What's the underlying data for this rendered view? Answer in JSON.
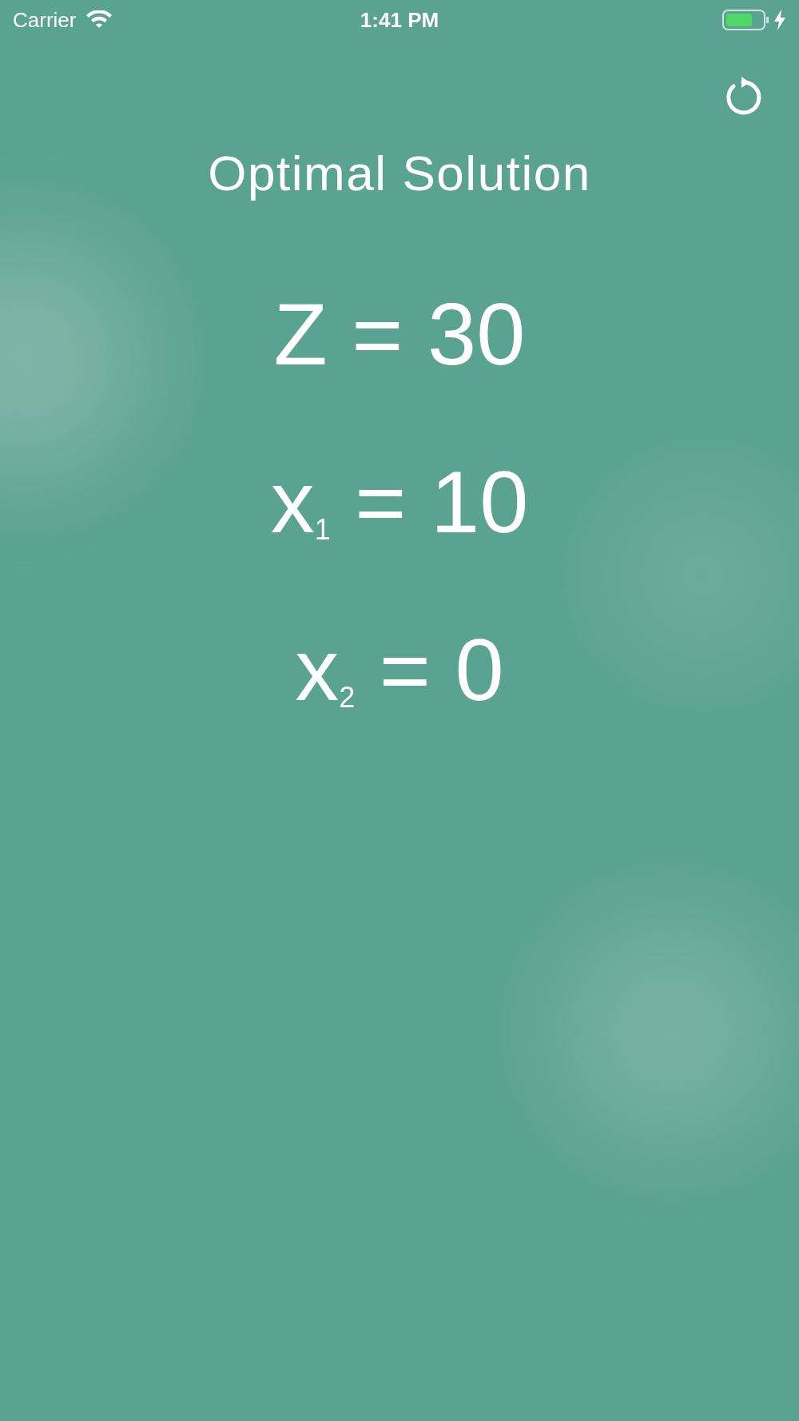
{
  "status_bar": {
    "carrier": "Carrier",
    "time": "1:41 PM"
  },
  "title": "Optimal Solution",
  "equations": [
    {
      "text": "Z = 30"
    },
    {
      "text": "x$_{1}$ = 10"
    },
    {
      "text": "x$_{2}$ = 0"
    }
  ]
}
